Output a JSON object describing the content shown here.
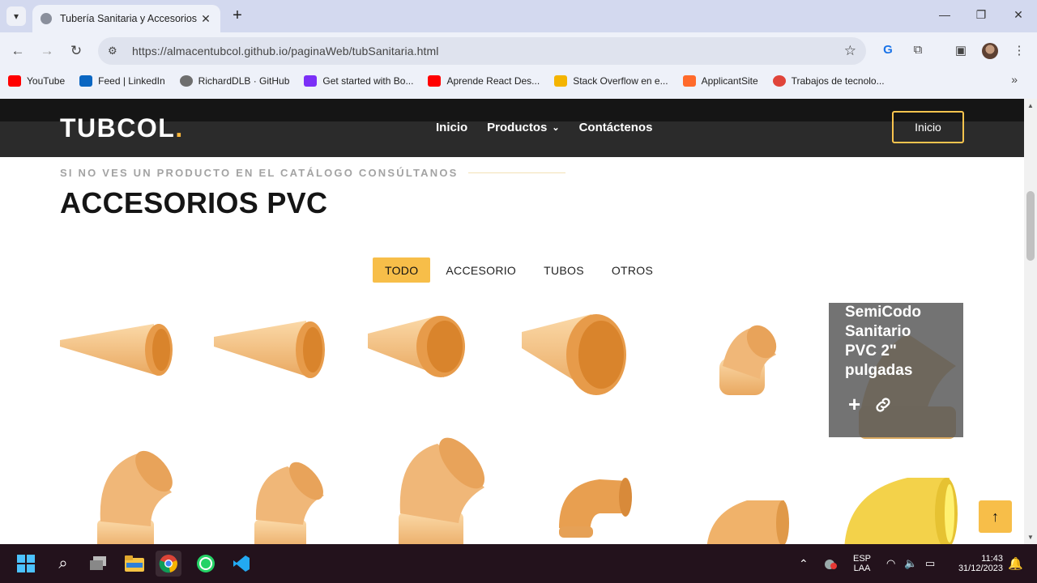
{
  "browser": {
    "tab_title": "Tubería Sanitaria y Accesorios",
    "tab_close": "✕",
    "new_tab": "+",
    "url": "https://almacentubcol.github.io/paginaWeb/tubSanitaria.html",
    "window_controls": [
      "—",
      "❐",
      "✕"
    ],
    "bookmarks": [
      {
        "label": "YouTube",
        "color": "#ff0000"
      },
      {
        "label": "Feed | LinkedIn",
        "color": "#0a66c2"
      },
      {
        "label": "RichardDLB · GitHub",
        "color": "#6e6e6e"
      },
      {
        "label": "Get started with Bo...",
        "color": "#7b2ff7"
      },
      {
        "label": "Aprende React Des...",
        "color": "#ff0000"
      },
      {
        "label": "Stack Overflow en e...",
        "color": "#f4b400"
      },
      {
        "label": "ApplicantSite",
        "color": "#ff6a2b"
      },
      {
        "label": "Trabajos de tecnolo...",
        "color": "#e0443a"
      }
    ],
    "bookmarks_more": "»"
  },
  "site": {
    "logo_text": "TUBCOL",
    "logo_dot": ".",
    "nav": {
      "inicio": "Inicio",
      "productos": "Productos",
      "contacto": "Contáctenos"
    },
    "cta": "Inicio",
    "eyebrow": "SI NO VES UN PRODUCTO EN EL CATÁLOGO CONSÚLTANOS",
    "title": "ACCESORIOS PVC",
    "filters": [
      "TODO",
      "ACCESORIO",
      "TUBOS",
      "OTROS"
    ],
    "active_filter": "TODO",
    "hover_product": {
      "title": "SemiCodo Sanitario PVC 2\" pulgadas",
      "add": "+",
      "link": "🔗"
    },
    "back_to_top": "↑",
    "accent": "#f7be49"
  },
  "taskbar": {
    "lang_top": "ESP",
    "lang_bottom": "LAA",
    "time": "11:43",
    "date": "31/12/2023"
  }
}
